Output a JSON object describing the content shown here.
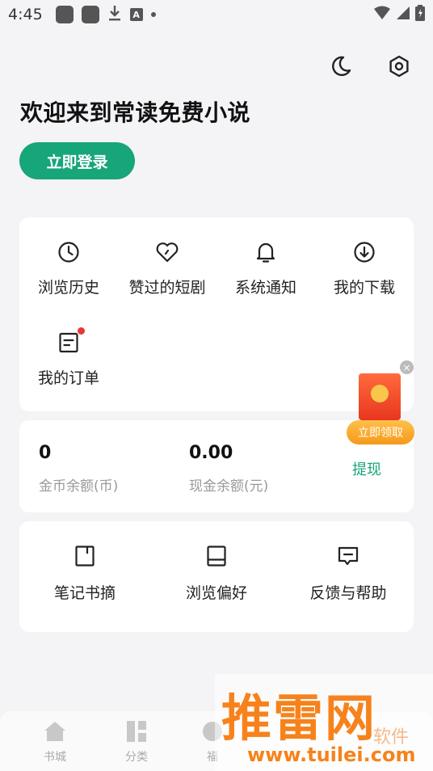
{
  "status_bar": {
    "time": "4:45",
    "icons": [
      "app-icon",
      "app-icon",
      "download-icon",
      "a-icon",
      "dot-icon",
      "wifi-icon",
      "signal-icon",
      "battery-icon"
    ]
  },
  "header": {
    "welcome": "欢迎来到常读免费小说",
    "login_label": "立即登录",
    "icons": [
      "moon-icon",
      "settings-icon"
    ]
  },
  "shortcuts": {
    "items": [
      {
        "label": "浏览历史",
        "icon": "clock-icon"
      },
      {
        "label": "赞过的短剧",
        "icon": "heart-icon"
      },
      {
        "label": "系统通知",
        "icon": "bell-icon"
      },
      {
        "label": "我的下载",
        "icon": "download-circle-icon"
      },
      {
        "label": "我的订单",
        "icon": "order-icon",
        "has_badge": true
      }
    ]
  },
  "balance": {
    "coins_value": "0",
    "coins_label": "金币余额(币)",
    "cash_value": "0.00",
    "cash_label": "现金余额(元)",
    "withdraw_label": "提现"
  },
  "tools": {
    "items": [
      {
        "label": "笔记书摘",
        "icon": "bookmark-icon"
      },
      {
        "label": "浏览偏好",
        "icon": "tablet-icon"
      },
      {
        "label": "反馈与帮助",
        "icon": "feedback-icon"
      }
    ]
  },
  "red_packet": {
    "button_label": "立即领取",
    "close_glyph": "×"
  },
  "bottom_nav": {
    "items": [
      {
        "label": "书城",
        "icon": "home-icon"
      },
      {
        "label": "分类",
        "icon": "category-icon"
      },
      {
        "label": "福",
        "icon": "welfare-icon"
      }
    ]
  },
  "watermark": {
    "brand": "推雷网",
    "url": "www.tuilei.com",
    "tagline": "软件"
  },
  "colors": {
    "accent": "#17a57a",
    "background": "#f4f4f6",
    "badge_red": "#e53935",
    "watermark": "#f7821b"
  }
}
